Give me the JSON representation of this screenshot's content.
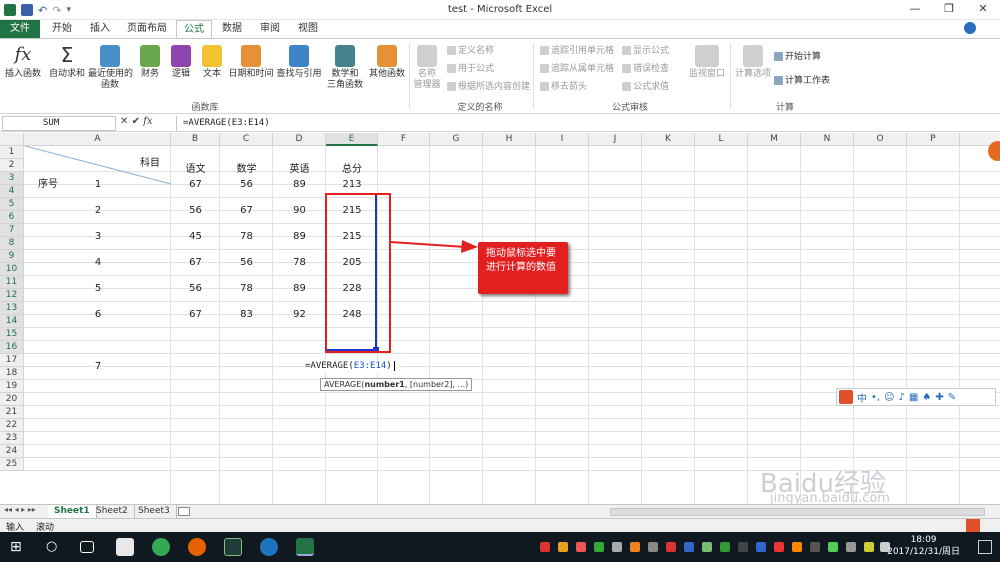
{
  "window": {
    "title": "test - Microsoft Excel"
  },
  "tabs": [
    "文件",
    "开始",
    "插入",
    "页面布局",
    "公式",
    "数据",
    "审阅",
    "视图"
  ],
  "ribbon": {
    "function_library": {
      "label": "函数库",
      "buttons": [
        "插入函数",
        "自动求和",
        "最近使用的\n函数",
        "财务",
        "逻辑",
        "文本",
        "日期和时间",
        "查找与引用",
        "数学和\n三角函数",
        "其他函数"
      ]
    },
    "defined_names": {
      "label": "定义的名称",
      "manager": "名称\n管理器",
      "items": [
        "定义名称",
        "用于公式",
        "根据所选内容创建"
      ]
    },
    "auditing": {
      "label": "公式审核",
      "items": [
        "追踪引用单元格",
        "显示公式",
        "追踪从属单元格",
        "错误检查",
        "移去箭头",
        "公式求值"
      ],
      "watch": "监视窗口"
    },
    "calculation": {
      "label": "计算",
      "options": "计算选项",
      "items": [
        "开始计算",
        "计算工作表"
      ]
    }
  },
  "formula_bar": {
    "name_box": "SUM",
    "formula": "=AVERAGE(E3:E14)"
  },
  "columns": [
    "A",
    "B",
    "C",
    "D",
    "E",
    "F",
    "G",
    "H",
    "I",
    "J",
    "K",
    "L",
    "M",
    "N",
    "O",
    "P"
  ],
  "rows": [
    "1",
    "2",
    "3",
    "4",
    "5",
    "6",
    "7",
    "8",
    "9",
    "10",
    "11",
    "12",
    "13",
    "14",
    "15",
    "16",
    "17",
    "18",
    "19",
    "20",
    "21",
    "22",
    "23",
    "24",
    "25"
  ],
  "sheet": {
    "header_subject": "科目",
    "header_index": "序号",
    "headers": [
      "语文",
      "数学",
      "英语",
      "总分"
    ],
    "data": [
      [
        "1",
        "67",
        "56",
        "89",
        "213"
      ],
      [
        "2",
        "56",
        "67",
        "90",
        "215"
      ],
      [
        "3",
        "45",
        "78",
        "89",
        "215"
      ],
      [
        "4",
        "67",
        "56",
        "78",
        "205"
      ],
      [
        "5",
        "56",
        "78",
        "89",
        "228"
      ],
      [
        "6",
        "67",
        "83",
        "92",
        "248"
      ]
    ],
    "row7_index": "7",
    "editing_formula_prefix": "=AVERAGE(",
    "editing_formula_ref": "E3:E14",
    "editing_formula_suffix": ")",
    "tooltip_fn": "AVERAGE(",
    "tooltip_bold": "number1",
    "tooltip_rest": ", [number2], ...)"
  },
  "callout": "拖动鼠标选中要进行计算的数值",
  "sheet_tabs": [
    "Sheet1",
    "Sheet2",
    "Sheet3"
  ],
  "status": [
    "输入",
    "滚动"
  ],
  "ime": "中",
  "clock": {
    "time": "18:09",
    "date": "2017/12/31/周日"
  },
  "watermark": {
    "brand": "Baidu经验",
    "url": "jingyan.baidu.com"
  },
  "colors": {
    "excel_green": "#217346",
    "callout_red": "#e32020",
    "selection_blue": "#2233cc",
    "ref_blue": "#1a4fd6"
  }
}
